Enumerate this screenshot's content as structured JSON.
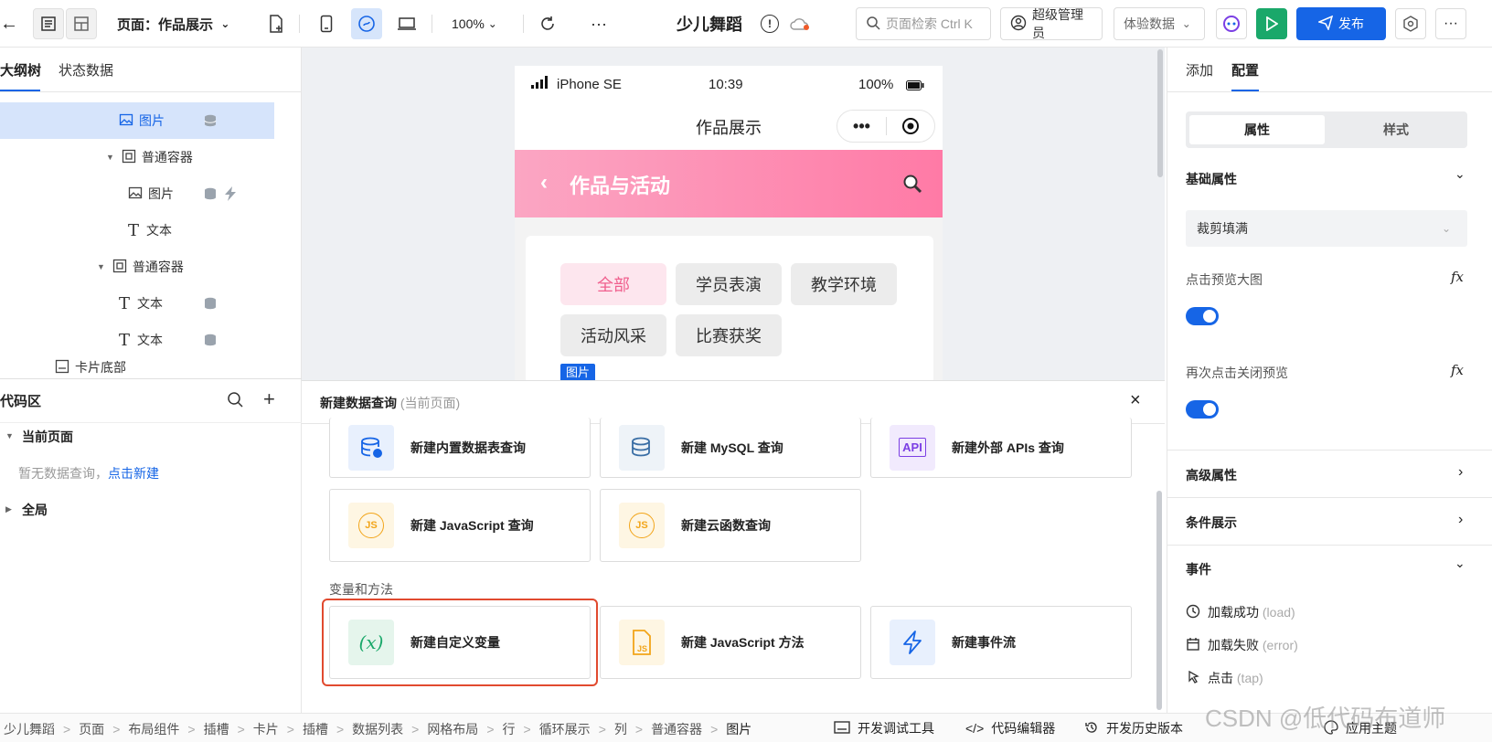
{
  "topbar": {
    "page_label": "页面：作品展示",
    "zoom": "100%",
    "app_title": "少儿舞蹈",
    "search_placeholder": "页面检索  Ctrl K",
    "admin_label": "超级管理员",
    "data_label": "体验数据",
    "publish_label": "发布",
    "more_label": "···"
  },
  "left": {
    "tabs": [
      "大纲树",
      "状态数据"
    ],
    "tree": [
      {
        "label": "图片",
        "icon": "image-icon"
      },
      {
        "label": "普通容器",
        "icon": "container-icon"
      },
      {
        "label": "图片",
        "icon": "image-icon"
      },
      {
        "label": "文本",
        "icon": "text-icon"
      },
      {
        "label": "普通容器",
        "icon": "container-icon"
      },
      {
        "label": "文本",
        "icon": "text-icon"
      },
      {
        "label": "文本",
        "icon": "text-icon"
      },
      {
        "label": "卡片底部",
        "icon": "card-footer-icon"
      }
    ],
    "code_title": "代码区",
    "current_page": "当前页面",
    "empty_text": "暂无数据查询，",
    "create_link": "点击新建",
    "global": "全局"
  },
  "phone": {
    "carrier": "iPhone SE",
    "time": "10:39",
    "battery": "100%",
    "nav_title": "作品展示",
    "banner_title": "作品与活动",
    "tags": [
      "全部",
      "学员表演",
      "教学环境",
      "活动风采",
      "比赛获奖"
    ],
    "image_badge": "图片"
  },
  "query_panel": {
    "title": "新建数据查询",
    "subtitle": "(当前页面)",
    "cards_row1": [
      "新建内置数据表查询",
      "新建 MySQL 查询",
      "新建外部 APIs 查询"
    ],
    "cards_row2": [
      "新建 JavaScript 查询",
      "新建云函数查询"
    ],
    "section_vars": "变量和方法",
    "cards_row3": [
      "新建自定义变量",
      "新建 JavaScript 方法",
      "新建事件流"
    ],
    "api_text": "API",
    "js_text": "JS",
    "var_text": "(x)"
  },
  "right": {
    "tabs": [
      "添加",
      "配置"
    ],
    "segments": [
      "属性",
      "样式"
    ],
    "basic_props": "基础属性",
    "fit_value": "裁剪填满",
    "preview_label": "点击预览大图",
    "close_preview_label": "再次点击关闭预览",
    "fx": "fx",
    "advanced": "高级属性",
    "condition": "条件展示",
    "events": "事件",
    "event_list": [
      {
        "label": "加载成功",
        "code": "(load)"
      },
      {
        "label": "加载失败",
        "code": "(error)"
      },
      {
        "label": "点击",
        "code": "(tap)"
      }
    ]
  },
  "breadcrumb": {
    "items": [
      "少儿舞蹈",
      "页面",
      "布局组件",
      "插槽",
      "卡片",
      "插槽",
      "数据列表",
      "网格布局",
      "行",
      "循环展示",
      "列",
      "普通容器",
      "图片"
    ],
    "tools": [
      "开发调试工具",
      "代码编辑器",
      "开发历史版本",
      "应用主题"
    ]
  },
  "watermark": "CSDN @低代码布道师",
  "colors": {
    "primary": "#1665e6",
    "green": "#1aa86a",
    "pink_gradient_start": "#fba6c3",
    "pink_gradient_end": "#ff7aa6",
    "highlight_red": "#e14a2f"
  }
}
